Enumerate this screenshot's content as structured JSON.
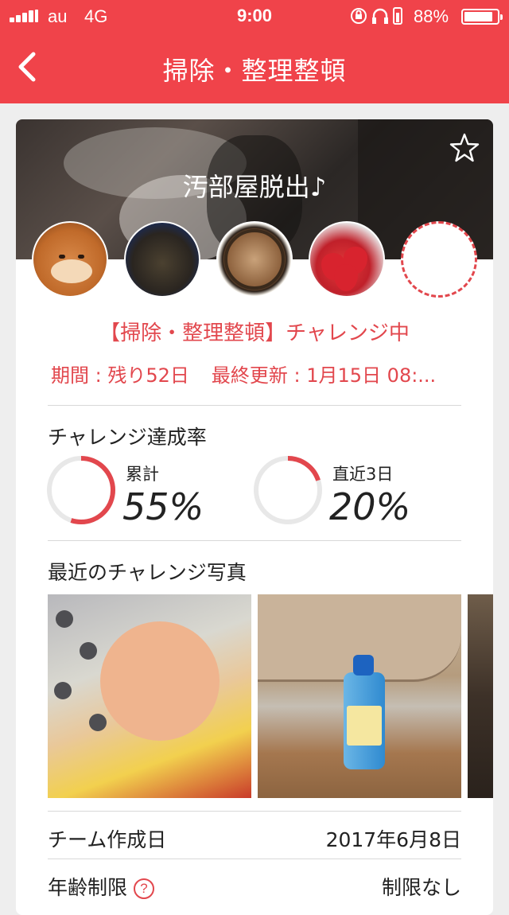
{
  "status_bar": {
    "carrier": "au",
    "network": "4G",
    "time": "9:00",
    "battery": "88%",
    "battery_level": 0.88
  },
  "nav": {
    "title": "掃除・整理整頓",
    "back_icon": "chevron-left-icon"
  },
  "team": {
    "name": "汚部屋脱出♪",
    "star_icon": "star-outline-icon",
    "status": "【掃除・整理整頓】チャレンジ中",
    "period": "期間 : 残り52日",
    "last_update": "最終更新 : 1月15日 08:..."
  },
  "stats": {
    "title": "チャレンジ達成率",
    "cumulative_label": "累計",
    "cumulative_value": "55%",
    "cumulative_fraction": 0.55,
    "recent_label": "直近3日",
    "recent_value": "20%",
    "recent_fraction": 0.2,
    "ring_color": "#e2474d",
    "ring_track_color": "#e8e8e8"
  },
  "photos": {
    "title": "最近のチャレンジ写真"
  },
  "info": {
    "created_label": "チーム作成日",
    "created_value": "2017年6月8日",
    "age_label": "年齢制限",
    "age_value": "制限なし",
    "help_glyph": "?"
  },
  "colors": {
    "accent": "#f0434a",
    "accent_text": "#e2474d"
  }
}
